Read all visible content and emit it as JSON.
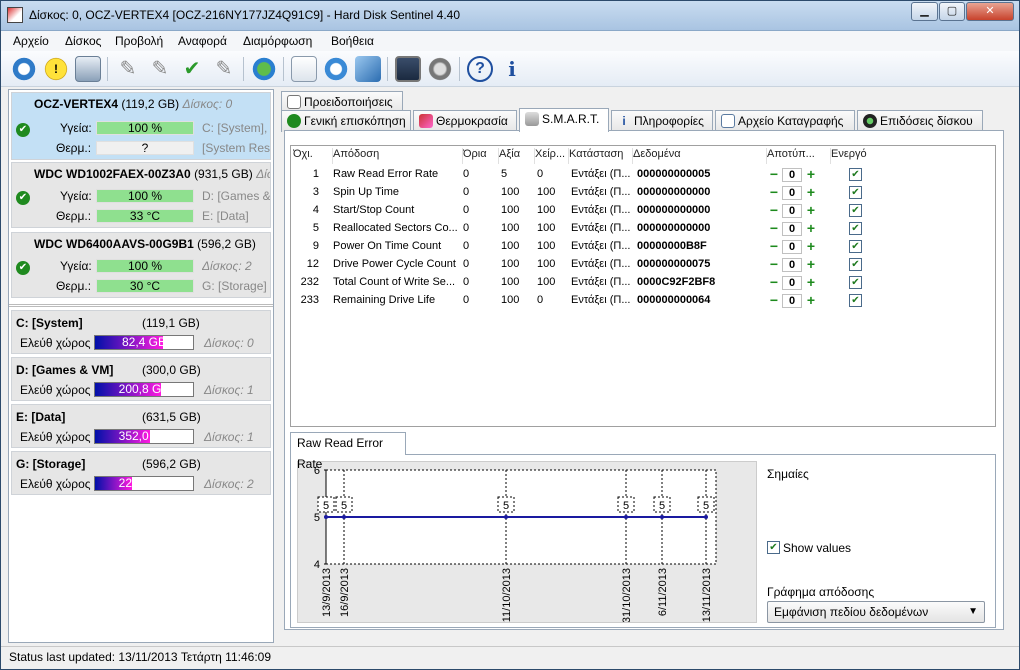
{
  "window": {
    "title": "Δίσκος: 0, OCZ-VERTEX4 [OCZ-216NY177JZ4Q91C9]  -  Hard Disk Sentinel 4.40"
  },
  "menu": [
    "Αρχείο",
    "Δίσκος",
    "Προβολή",
    "Αναφορά",
    "Διαμόρφωση",
    "Βοήθεια"
  ],
  "toolbar_icons": [
    "refresh-icon",
    "warning-icon",
    "disk-icon",
    "wrench-icon",
    "wrench-settings-icon",
    "wrench-check-icon",
    "wrench-alt-icon",
    "globe-icon",
    "report-icon",
    "update-icon",
    "network-icon",
    "monitor-icon",
    "speaker-icon",
    "help-icon",
    "info-icon"
  ],
  "disks": [
    {
      "name": "OCZ-VERTEX4",
      "size": "(119,2 GB)",
      "disk": "Δίσκος: 0",
      "health_label": "Υγεία:",
      "health": "100 %",
      "health_pct": 100,
      "temp_label": "Θερμ.:",
      "temp": "?",
      "side1": "C: [System],",
      "side2": "[System Rese"
    },
    {
      "name": "WDC WD1002FAEX-00Z3A0",
      "size": "(931,5 GB)",
      "disk": "Δίσκ",
      "health_label": "Υγεία:",
      "health": "100 %",
      "health_pct": 100,
      "temp_label": "Θερμ.:",
      "temp": "33 °C",
      "side1": "D: [Games &",
      "side2": "E: [Data]"
    },
    {
      "name": "WDC WD6400AAVS-00G9B1",
      "size": "(596,2 GB)",
      "disk": "",
      "health_label": "Υγεία:",
      "health": "100 %",
      "health_pct": 100,
      "temp_label": "Θερμ.:",
      "temp": "30 °C",
      "side1": "Δίσκος: 2",
      "side2": "G: [Storage]"
    }
  ],
  "volumes": [
    {
      "name": "C: [System]",
      "size": "(119,1 GB)",
      "free_label": "Ελεύθ χώρος",
      "free": "82,4 GB",
      "free_pct": 69,
      "disk": "Δίσκος: 0"
    },
    {
      "name": "D: [Games & VM]",
      "size": "(300,0 GB)",
      "free_label": "Ελεύθ χώρος",
      "free": "200,8 GB",
      "free_pct": 67,
      "disk": "Δίσκος: 1"
    },
    {
      "name": "E: [Data]",
      "size": "(631,5 GB)",
      "free_label": "Ελεύθ χώρος",
      "free": "352,0 GB",
      "free_pct": 56,
      "disk": "Δίσκος: 1"
    },
    {
      "name": "G: [Storage]",
      "size": "(596,2 GB)",
      "free_label": "Ελεύθ χώρος",
      "free": "225,0 GB",
      "free_pct": 38,
      "disk": "Δίσκος: 2"
    }
  ],
  "tabs": {
    "warnings": "Προειδοποιήσεις",
    "items": [
      "Γενική επισκόπηση",
      "Θερμοκρασία",
      "S.M.A.R.T.",
      "Πληροφορίες",
      "Αρχείο Καταγραφής",
      "Επιδόσεις δίσκου"
    ],
    "active": "S.M.A.R.T."
  },
  "smart": {
    "headers": [
      "Όχι.",
      "Απόδοση",
      "Όρια",
      "Αξία",
      "Χείρ...",
      "Κατάσταση",
      "Δεδομένα",
      "Αποτύπ...",
      "Ενεργό"
    ],
    "rows": [
      {
        "id": "1",
        "attr": "Raw Read Error Rate",
        "threshold": "0",
        "value": "5",
        "worst": "0",
        "status": "Εντάξει (Π...",
        "data": "000000000005",
        "offset": "0",
        "active": true
      },
      {
        "id": "3",
        "attr": "Spin Up Time",
        "threshold": "0",
        "value": "100",
        "worst": "100",
        "status": "Εντάξει (Π...",
        "data": "000000000000",
        "offset": "0",
        "active": true
      },
      {
        "id": "4",
        "attr": "Start/Stop Count",
        "threshold": "0",
        "value": "100",
        "worst": "100",
        "status": "Εντάξει (Π...",
        "data": "000000000000",
        "offset": "0",
        "active": true
      },
      {
        "id": "5",
        "attr": "Reallocated Sectors Co...",
        "threshold": "0",
        "value": "100",
        "worst": "100",
        "status": "Εντάξει (Π...",
        "data": "000000000000",
        "offset": "0",
        "active": true
      },
      {
        "id": "9",
        "attr": "Power On Time Count",
        "threshold": "0",
        "value": "100",
        "worst": "100",
        "status": "Εντάξει (Π...",
        "data": "00000000B8F",
        "offset": "0",
        "active": true
      },
      {
        "id": "12",
        "attr": "Drive Power Cycle Count",
        "threshold": "0",
        "value": "100",
        "worst": "100",
        "status": "Εντάξει (Π...",
        "data": "000000000075",
        "offset": "0",
        "active": true
      },
      {
        "id": "232",
        "attr": "Total Count of Write Se...",
        "threshold": "0",
        "value": "100",
        "worst": "100",
        "status": "Εντάξει (Π...",
        "data": "0000C92F2BF8",
        "offset": "0",
        "active": true
      },
      {
        "id": "233",
        "attr": "Remaining Drive Life",
        "threshold": "0",
        "value": "100",
        "worst": "0",
        "status": "Εντάξει (Π...",
        "data": "000000000064",
        "offset": "0",
        "active": true
      }
    ]
  },
  "graph": {
    "tab": "Raw Read Error Rate",
    "flags_label": "Σημαίες",
    "show_values_label": "Show values",
    "show_values_checked": true,
    "graph_label": "Γράφημα απόδοσης",
    "graph_select": "Εμφάνιση πεδίου δεδομένων"
  },
  "chart_data": {
    "type": "line",
    "x": [
      "13/9/2013",
      "16/9/2013",
      "11/10/2013",
      "31/10/2013",
      "6/11/2013",
      "13/11/2013"
    ],
    "values": [
      5,
      5,
      5,
      5,
      5,
      5
    ],
    "data_labels": [
      "5",
      "5",
      "5",
      "5",
      "5",
      "5"
    ],
    "ylim": [
      4,
      6
    ],
    "yticks": [
      "4",
      "5",
      "6"
    ],
    "series_color": "#1a1aa0"
  },
  "status": {
    "text": "Status last updated: 13/11/2013 Τετάρτη 11:46:09"
  }
}
